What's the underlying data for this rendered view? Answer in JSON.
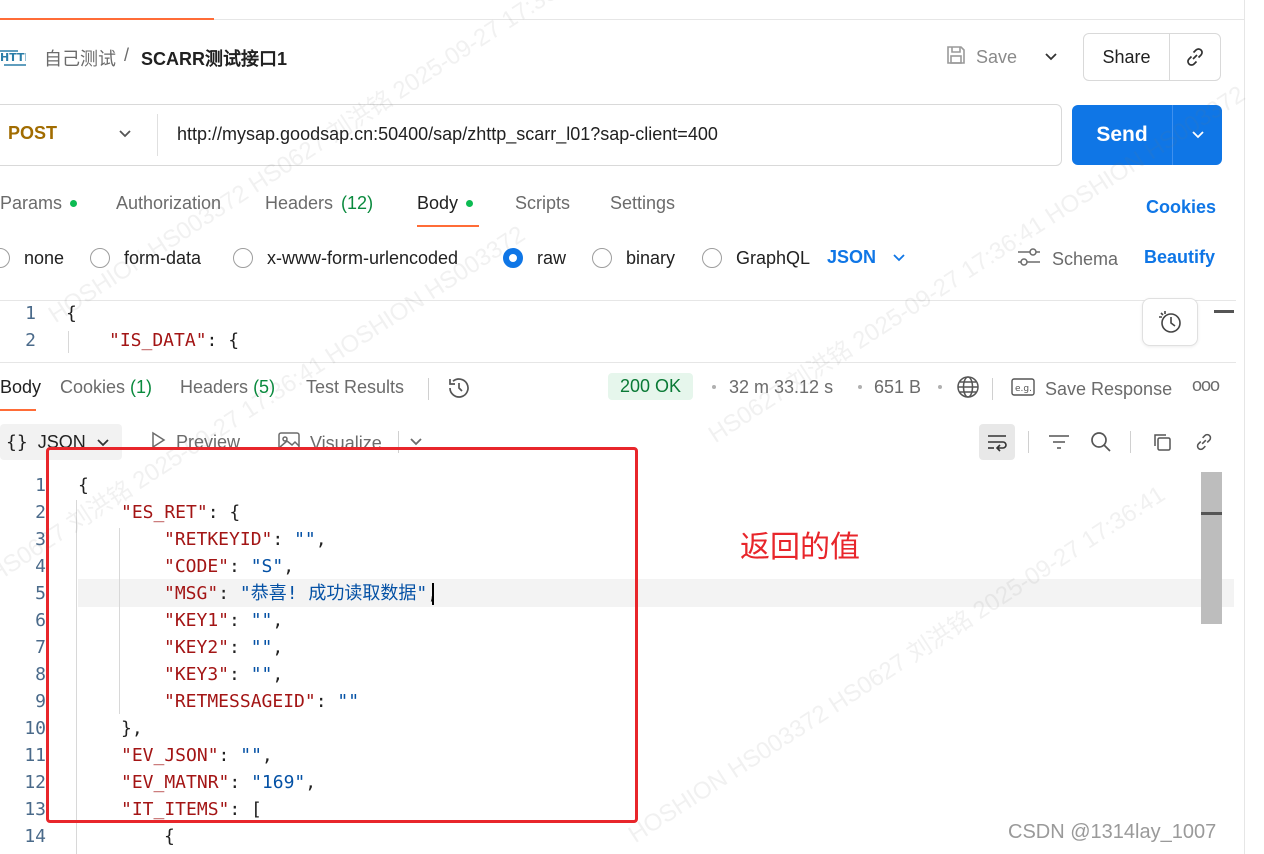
{
  "breadcrumb": {
    "collection": "自己测试",
    "separator": "/",
    "request_name": "SCARR测试接口1"
  },
  "header": {
    "save_label": "Save",
    "share_label": "Share"
  },
  "request": {
    "method": "POST",
    "url": "http://mysap.goodsap.cn:50400/sap/zhttp_scarr_l01?sap-client=400",
    "send_label": "Send"
  },
  "request_tabs": {
    "params": "Params",
    "authorization": "Authorization",
    "headers": "Headers",
    "headers_count": "(12)",
    "body": "Body",
    "scripts": "Scripts",
    "settings": "Settings",
    "cookies": "Cookies"
  },
  "body_types": {
    "none": "none",
    "form_data": "form-data",
    "urlencoded": "x-www-form-urlencoded",
    "raw": "raw",
    "binary": "binary",
    "graphql": "GraphQL",
    "format": "JSON",
    "schema": "Schema",
    "beautify": "Beautify",
    "selected": "raw"
  },
  "request_body_lines": [
    {
      "n": "1",
      "text": "{"
    },
    {
      "n": "2",
      "key": "\"IS_DATA\"",
      "rest": ": {"
    }
  ],
  "response_tabs": {
    "body": "Body",
    "cookies": "Cookies",
    "cookies_count": "(1)",
    "headers": "Headers",
    "headers_count": "(5)",
    "test_results": "Test Results"
  },
  "response_meta": {
    "status": "200 OK",
    "time": "32 m 33.12 s",
    "size": "651 B",
    "save_response": "Save Response",
    "more": "ooo"
  },
  "response_toolbar": {
    "format": "JSON",
    "preview": "Preview",
    "visualize": "Visualize"
  },
  "response_lines": [
    {
      "n": "1",
      "indent": 0,
      "text": "{"
    },
    {
      "n": "2",
      "indent": 1,
      "key": "\"ES_RET\"",
      "rest": ": {"
    },
    {
      "n": "3",
      "indent": 2,
      "key": "\"RETKEYID\"",
      "sep": ": ",
      "val": "\"\"",
      "tail": ","
    },
    {
      "n": "4",
      "indent": 2,
      "key": "\"CODE\"",
      "sep": ": ",
      "val": "\"S\"",
      "tail": ","
    },
    {
      "n": "5",
      "indent": 2,
      "key": "\"MSG\"",
      "sep": ": ",
      "val": "\"恭喜! 成功读取数据\"",
      "tail": ","
    },
    {
      "n": "6",
      "indent": 2,
      "key": "\"KEY1\"",
      "sep": ": ",
      "val": "\"\"",
      "tail": ","
    },
    {
      "n": "7",
      "indent": 2,
      "key": "\"KEY2\"",
      "sep": ": ",
      "val": "\"\"",
      "tail": ","
    },
    {
      "n": "8",
      "indent": 2,
      "key": "\"KEY3\"",
      "sep": ": ",
      "val": "\"\"",
      "tail": ","
    },
    {
      "n": "9",
      "indent": 2,
      "key": "\"RETMESSAGEID\"",
      "sep": ": ",
      "val": "\"\"",
      "tail": ""
    },
    {
      "n": "10",
      "indent": 1,
      "text": "},"
    },
    {
      "n": "11",
      "indent": 1,
      "key": "\"EV_JSON\"",
      "sep": ": ",
      "val": "\"\"",
      "tail": ","
    },
    {
      "n": "12",
      "indent": 1,
      "key": "\"EV_MATNR\"",
      "sep": ": ",
      "val": "\"169\"",
      "tail": ","
    },
    {
      "n": "13",
      "indent": 1,
      "key": "\"IT_ITEMS\"",
      "rest": ": ["
    },
    {
      "n": "14",
      "indent": 2,
      "text": "{"
    }
  ],
  "annotation": "返回的值",
  "watermark": {
    "text_a": "HOSHION HS003372 HS0627 刘洪铭 2025-09-27 17:36:41",
    "text_b": "HS0627 刘洪铭 2025-09-27 17:36:41 HOSHION HS003372"
  },
  "credit": "CSDN @1314lay_1007",
  "colors": {
    "accent": "#ff6c37",
    "primary": "#0f76e6",
    "method": "#a16c00",
    "status_ok": "#0a7a36",
    "annotation": "#e8262b"
  }
}
